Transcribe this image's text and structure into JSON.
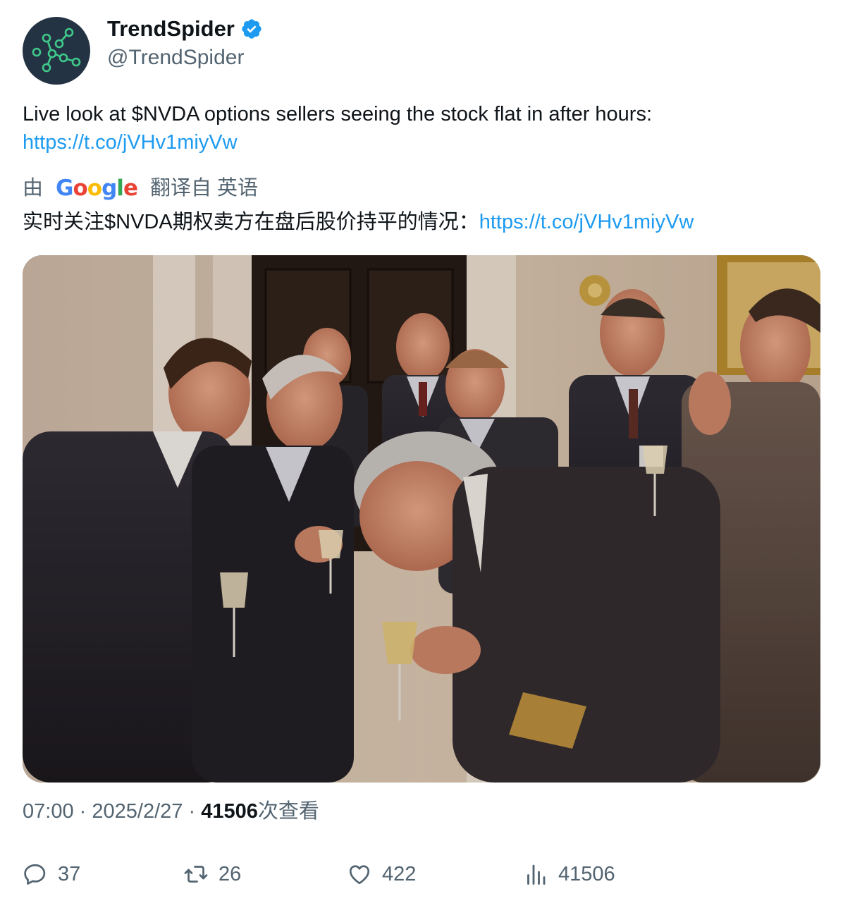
{
  "author": {
    "display_name": "TrendSpider",
    "handle": "@TrendSpider",
    "verified": true,
    "avatar_icon": "trendspider-logo-icon"
  },
  "tweet": {
    "text": "Live look at $NVDA options sellers seeing the stock flat in after hours:",
    "link": "https://t.co/jVHv1miyVw"
  },
  "translation": {
    "prefix": "由",
    "provider": "Google",
    "suffix": "翻译自 英语",
    "text": "实时关注$NVDA期权卖方在盘后股价持平的情况：",
    "link": "https://t.co/jVHv1miyVw"
  },
  "media": {
    "type": "photo"
  },
  "meta": {
    "time": "07:00",
    "separator": "·",
    "date": "2025/2/27",
    "views_count": "41506",
    "views_label": "次查看"
  },
  "actions": {
    "replies": "37",
    "retweets": "26",
    "likes": "422",
    "views": "41506"
  },
  "colors": {
    "link": "#1d9bf0",
    "verified": "#1d9bf0",
    "secondary_text": "#536471"
  }
}
